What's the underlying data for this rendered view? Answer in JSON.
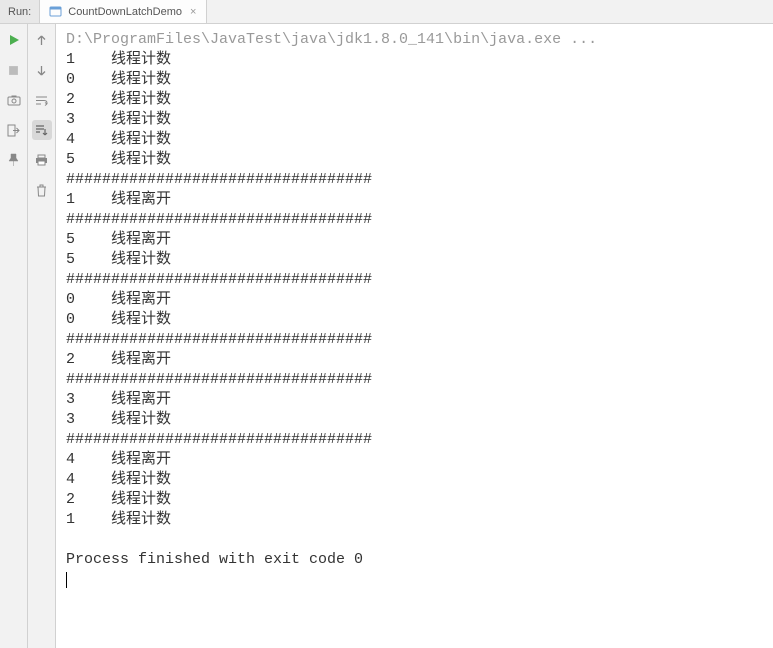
{
  "tab_bar": {
    "run_label": "Run:",
    "tab_title": "CountDownLatchDemo",
    "close_glyph": "×"
  },
  "toolbar_left": {
    "items": [
      "run",
      "stop",
      "camera",
      "exit",
      "pin"
    ]
  },
  "toolbar_mid": {
    "items": [
      "up",
      "down",
      "toggle",
      "wrap",
      "print",
      "trash"
    ]
  },
  "console": {
    "header": "D:\\ProgramFiles\\JavaTest\\java\\jdk1.8.0_141\\bin\\java.exe ...",
    "lines": [
      "1    线程计数",
      "0    线程计数",
      "2    线程计数",
      "3    线程计数",
      "4    线程计数",
      "5    线程计数",
      "##################################",
      "1    线程离开",
      "##################################",
      "5    线程离开",
      "5    线程计数",
      "##################################",
      "0    线程离开",
      "0    线程计数",
      "##################################",
      "2    线程离开",
      "##################################",
      "3    线程离开",
      "3    线程计数",
      "##################################",
      "4    线程离开",
      "4    线程计数",
      "2    线程计数",
      "1    线程计数",
      "",
      "Process finished with exit code 0"
    ]
  }
}
